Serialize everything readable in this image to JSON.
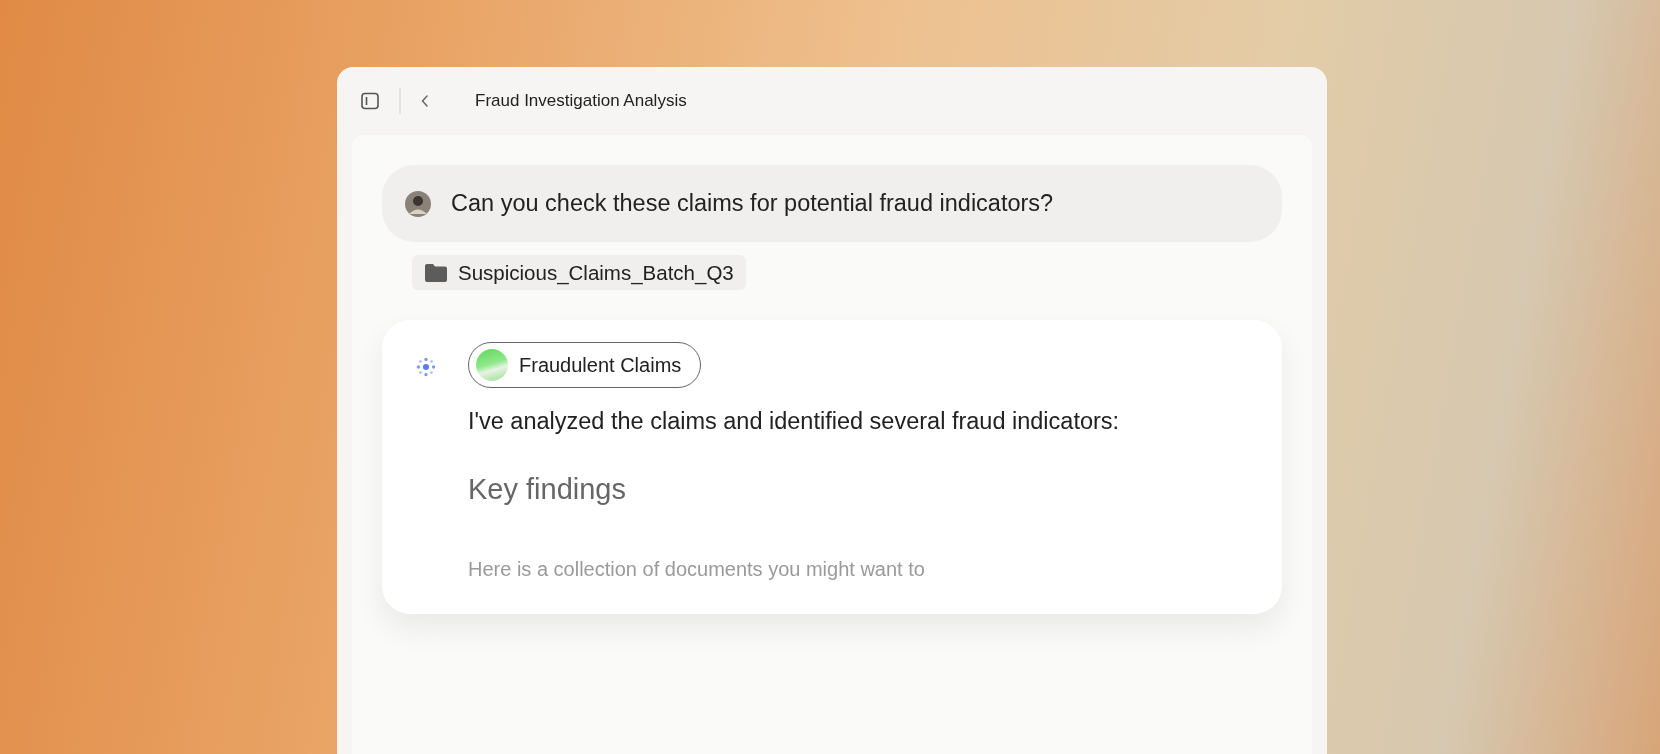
{
  "window": {
    "title": "Fraud Investigation Analysis"
  },
  "user_message": {
    "text": "Can you check these claims for potential fraud indicators?"
  },
  "attachment": {
    "name": "Suspicious_Claims_Batch_Q3"
  },
  "assistant_message": {
    "source_chip": "Fraudulent Claims",
    "intro": "I've analyzed the claims and identified several fraud indicators:",
    "heading": "Key findings",
    "faded_text": "Here is a collection of documents you might want to"
  }
}
